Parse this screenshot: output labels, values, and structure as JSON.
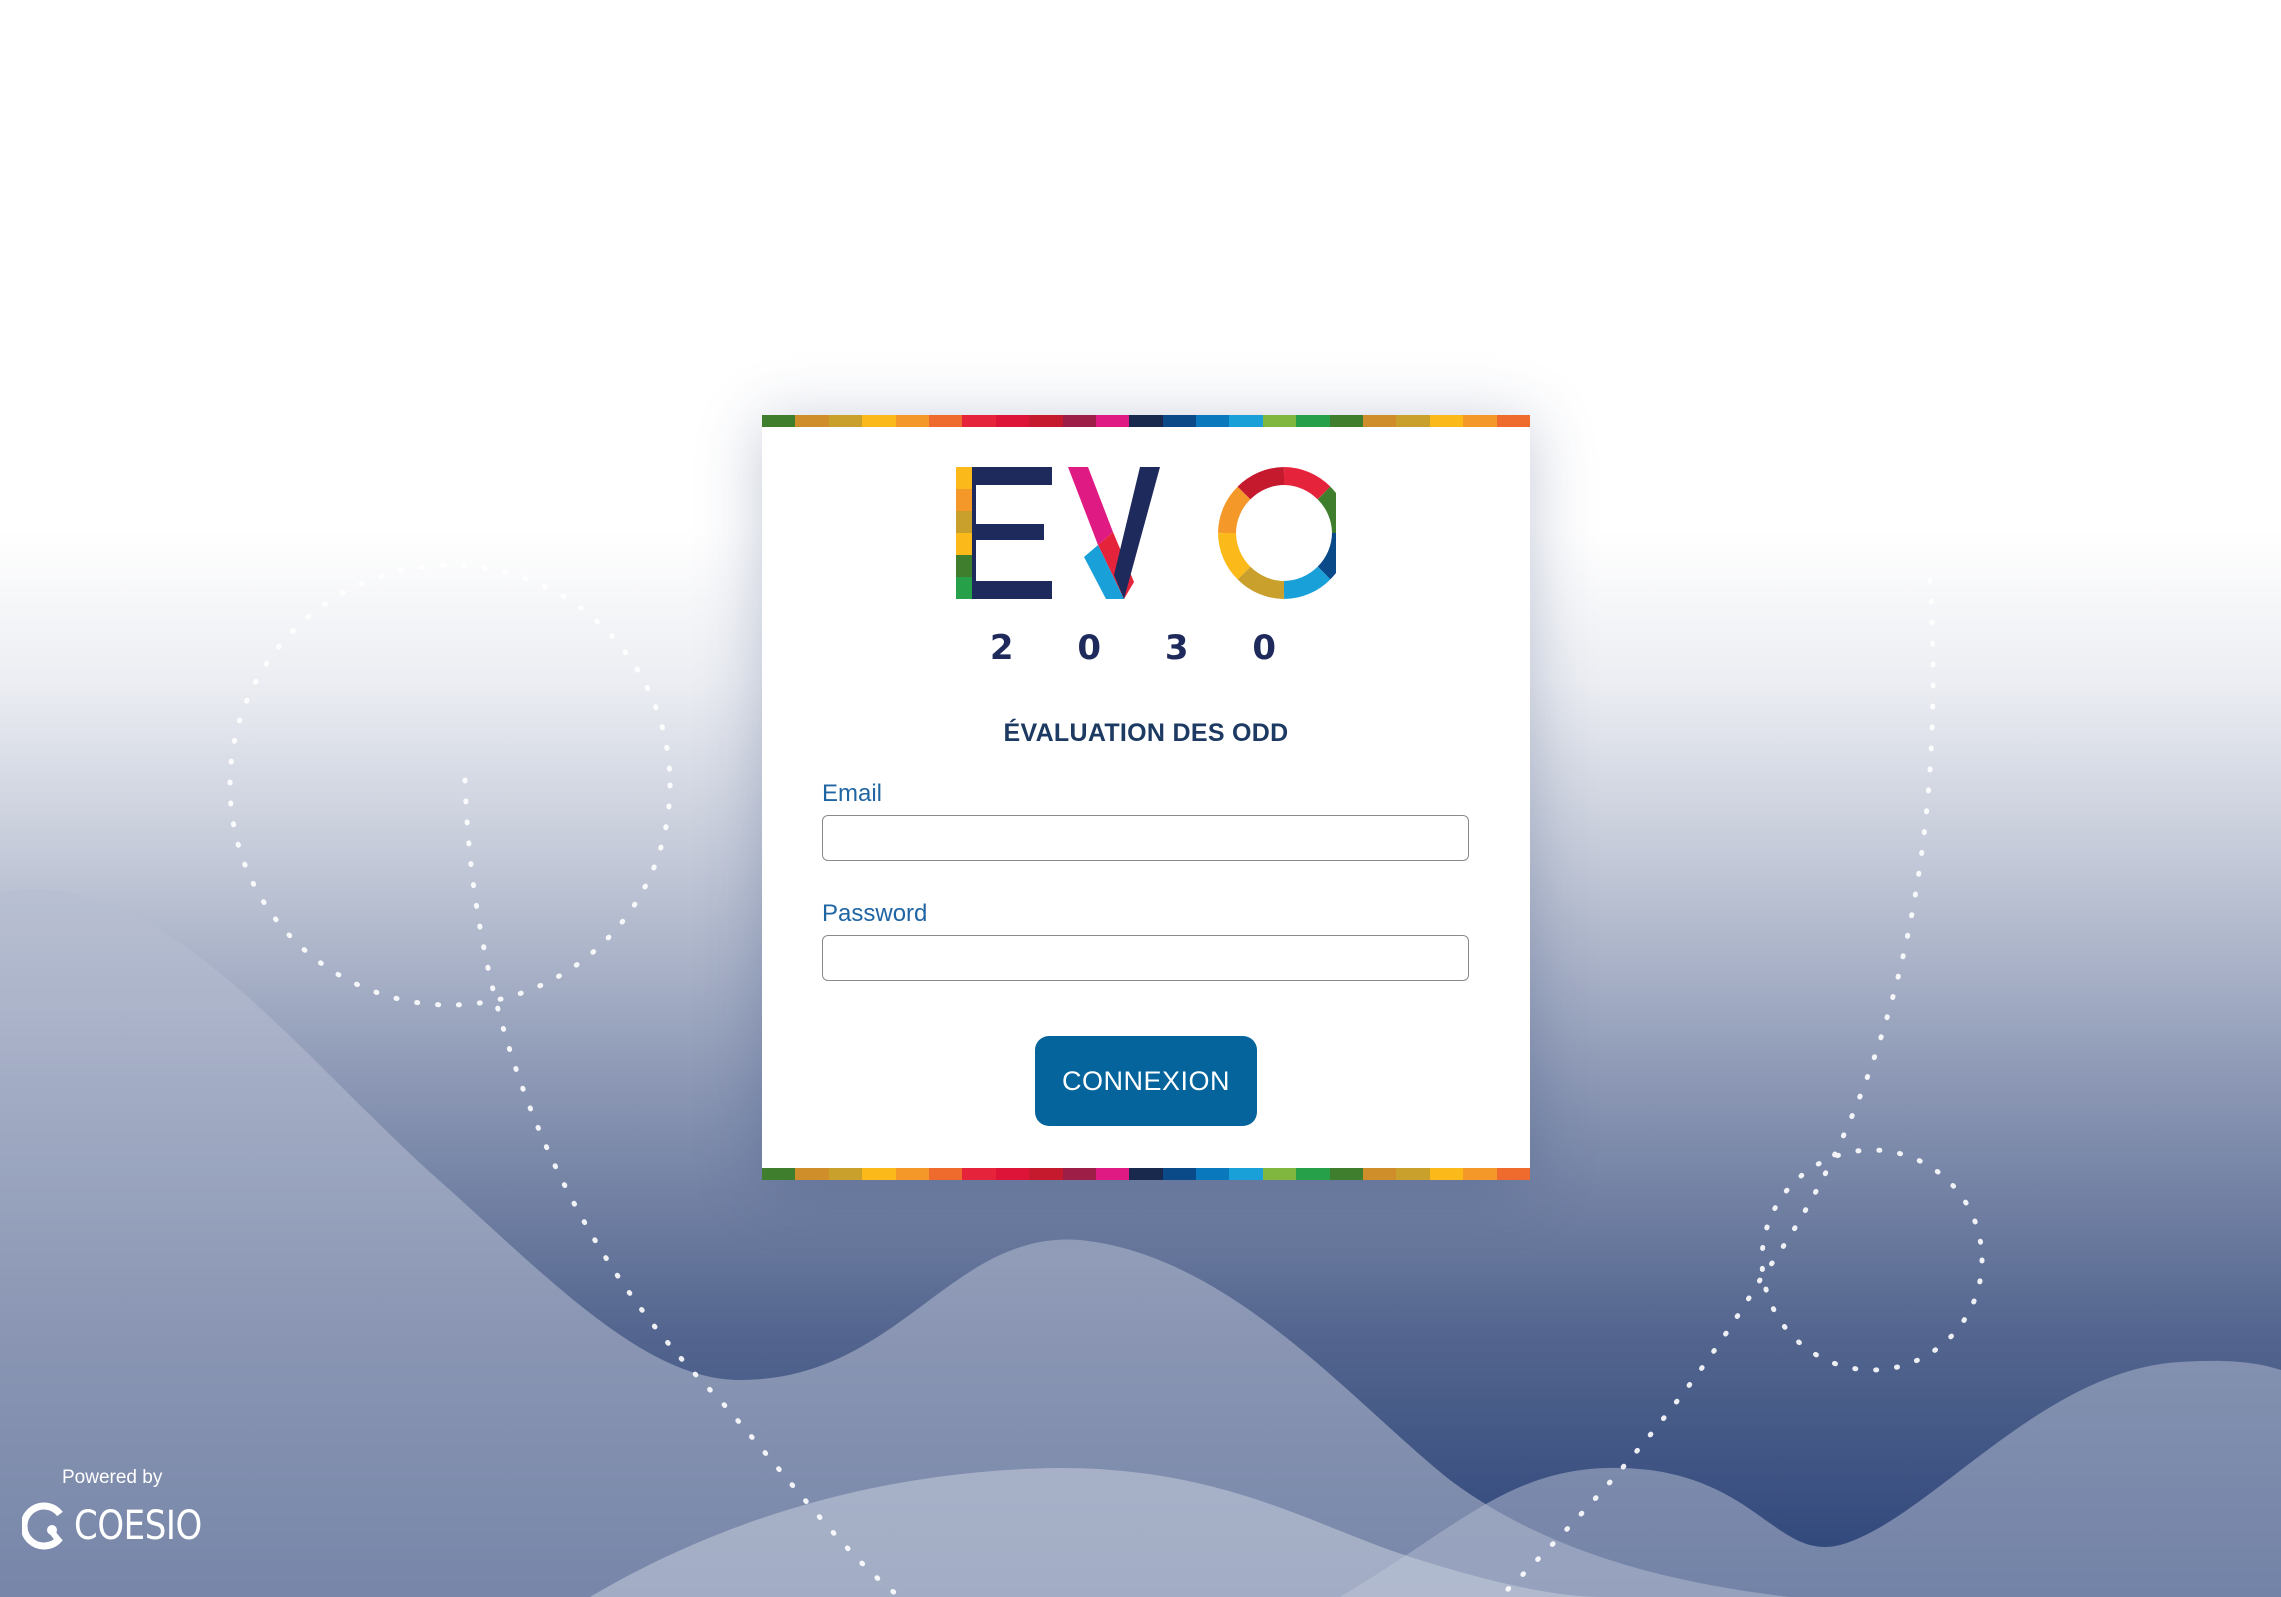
{
  "app": {
    "subtitle": "ÉVALUATION DES ODD",
    "brand_colors": {
      "navy": "#1f2a5c",
      "primary_button": "#05649c",
      "label_blue": "#1f65a3"
    }
  },
  "logo": {
    "main_text": "EVO",
    "year_text": "2 0 3 0"
  },
  "sdg_palette": [
    "#3f7e2c",
    "#cf8e2a",
    "#c9a02c",
    "#fbba19",
    "#f4982a",
    "#ee6b2d",
    "#e5243b",
    "#dd1338",
    "#c5192d",
    "#9d1f48",
    "#e01a83",
    "#19284d",
    "#0a4a89",
    "#0a78bd",
    "#19a0d9",
    "#7fb73f",
    "#26a14a",
    "#3f7e2c",
    "#cf8e2a",
    "#c9a02c",
    "#fbba19",
    "#f4982a",
    "#ee6b2d"
  ],
  "form": {
    "email_label": "Email",
    "email_value": "",
    "email_placeholder": "",
    "password_label": "Password",
    "password_value": "",
    "password_placeholder": "",
    "submit_label": "CONNEXION"
  },
  "footer": {
    "powered_by": "Powered by",
    "brand_name": "COESIO"
  }
}
